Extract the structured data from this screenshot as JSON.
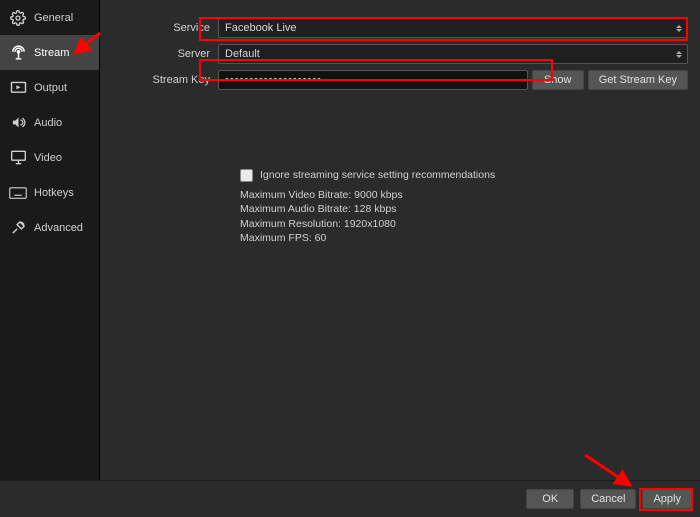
{
  "sidebar": {
    "items": [
      {
        "label": "General"
      },
      {
        "label": "Stream"
      },
      {
        "label": "Output"
      },
      {
        "label": "Audio"
      },
      {
        "label": "Video"
      },
      {
        "label": "Hotkeys"
      },
      {
        "label": "Advanced"
      }
    ]
  },
  "form": {
    "service_label": "Service",
    "service_value": "Facebook Live",
    "server_label": "Server",
    "server_value": "Default",
    "streamkey_label": "Stream Key",
    "streamkey_value": "••••••••••••••••••••",
    "show_btn": "Show",
    "get_btn": "Get Stream Key"
  },
  "settings": {
    "checkbox_label": "Ignore streaming service setting recommendations",
    "line1": "Maximum Video Bitrate: 9000 kbps",
    "line2": "Maximum Audio Bitrate: 128 kbps",
    "line3": "Maximum Resolution: 1920x1080",
    "line4": "Maximum FPS: 60"
  },
  "footer": {
    "ok": "OK",
    "cancel": "Cancel",
    "apply": "Apply"
  }
}
